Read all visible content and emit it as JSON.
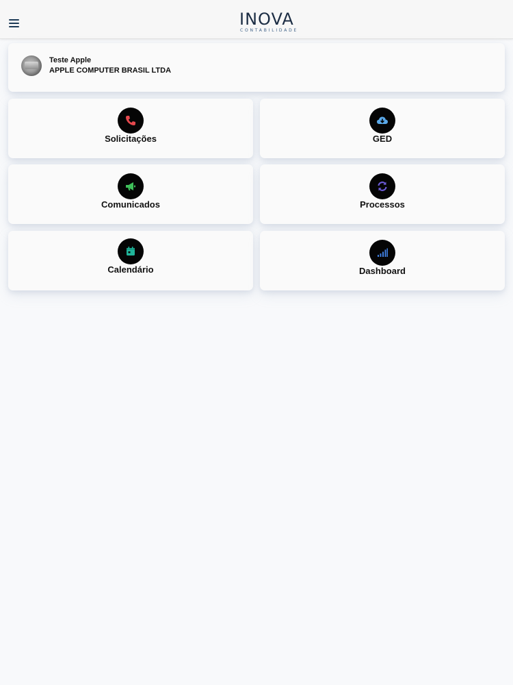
{
  "header": {
    "logo_text": "INOVA",
    "logo_subtext": "CONTABILIDADE",
    "menu_icon": "hamburger-menu-icon"
  },
  "profile": {
    "name": "Teste Apple",
    "company": "APPLE COMPUTER BRASIL LTDA"
  },
  "tiles": [
    {
      "label": "Solicitações",
      "icon": "phone-icon",
      "icon_color": "#e5484d"
    },
    {
      "label": "GED",
      "icon": "cloud-download-icon",
      "icon_color": "#5aa8e8"
    },
    {
      "label": "Comunicados",
      "icon": "megaphone-icon",
      "icon_color": "#3fbf5a"
    },
    {
      "label": "Processos",
      "icon": "sync-icon",
      "icon_color": "#6b5bd6"
    },
    {
      "label": "Calendário",
      "icon": "calendar-icon",
      "icon_color": "#20b59a"
    },
    {
      "label": "Dashboard",
      "icon": "signal-bars-icon",
      "icon_color": "#3f7ee0"
    }
  ],
  "colors": {
    "brand": "#1c2d44",
    "background": "#f8f9fb"
  }
}
